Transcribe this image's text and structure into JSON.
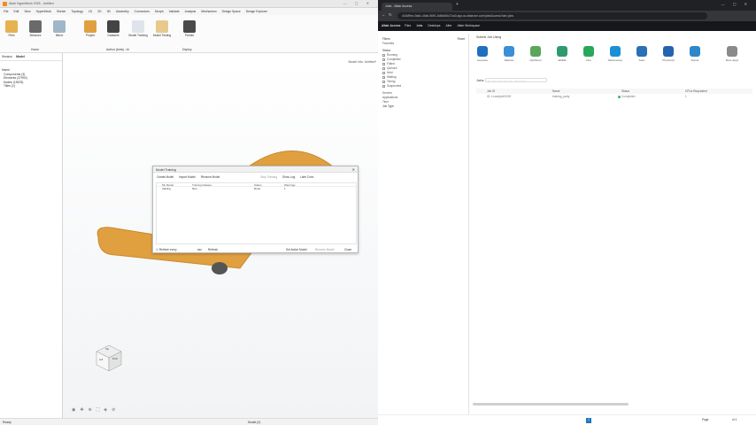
{
  "left_app": {
    "title": "Altair HyperMesh 2025 - Untitled",
    "menu": [
      "File",
      "Edit",
      "View",
      "HyperMesh",
      "Sketch",
      "Topology",
      "1D",
      "2D",
      "3D",
      "Assembly",
      "Connectors",
      "Morph",
      "Validate",
      "Analysis",
      "Mechanism",
      "Design Space",
      "Design Explorer"
    ],
    "ribbon_tools": [
      {
        "name": "files-tool",
        "label": "Files"
      },
      {
        "name": "measure-tool",
        "label": "Measure"
      },
      {
        "name": "mirror-tool",
        "label": "Mirror"
      },
      {
        "name": "project-tool",
        "label": "Project"
      },
      {
        "name": "datasets-tool",
        "label": "Datasets"
      },
      {
        "name": "model-training-tool",
        "label": "Model Training"
      },
      {
        "name": "model-testing-tool",
        "label": "Model Testing"
      },
      {
        "name": "predict-tool",
        "label": "Predict"
      }
    ],
    "group_home": "Home",
    "group_author": "Author (beta) - AI",
    "group_deploy": "Deploy",
    "browser_tabs": [
      "Session",
      "Model"
    ],
    "tree_header": "Name",
    "tree": [
      "Components (3)",
      "Elements (37992)",
      "Nodes (19678)",
      "Titles (1)"
    ],
    "viewport_label": "Model Info: Untitled*",
    "status": "Ready",
    "status_center": "Model (2)",
    "viewcube": {
      "top": "Top",
      "left": "Left",
      "front": "Front"
    }
  },
  "dialog": {
    "title": "Model Training",
    "toolbar": [
      "Create Model",
      "Import Model",
      "Remove Model",
      "Stop Training",
      "Show Log",
      "Liste Conn"
    ],
    "columns": [
      "ML Model",
      "Training Dataset",
      "Status",
      "Warnings"
    ],
    "row": {
      "model": "training",
      "dataset": "Nan",
      "status": "Done",
      "warnings": "1"
    },
    "footer_left": "Refresh every",
    "footer_sec": "sec",
    "footer_refresh": "Refresh",
    "footer_buttons": [
      "Set Active Model",
      "Remove Model",
      "Close"
    ]
  },
  "right_app": {
    "tab_active": "Jobs - Altair Access",
    "url": "415df9ec-9a6c-44bd-9691-5d5db8417ca0.app.az.altairone.com/jobs/Access?tab=jobs",
    "brand": "Altair Access",
    "nav": [
      "Files",
      "Jobs",
      "Desktops",
      "Alter",
      "Altair Workspace"
    ],
    "filters_title": "Filters",
    "filters_reset": "Reset",
    "filter_sub": "Favorites",
    "status_title": "Status",
    "statuses": [
      "Running",
      "Completed",
      "Failed",
      "Queued",
      "Held",
      "Waiting",
      "Timing",
      "Suspended"
    ],
    "more_filters": [
      "Servers",
      "Applications",
      "Time",
      "Job Type"
    ],
    "submit_title": "Submit Job Using",
    "solvers": [
      "Acusolve",
      "Radioss",
      "OptiStruct",
      "EDEM",
      "Flux",
      "Motionsolve",
      "Feko",
      "PhysicsAI",
      "Romai",
      "More Apps"
    ],
    "jobs_title": "Jobs",
    "search_placeholder": "Search using job name, job id, host",
    "columns": [
      "Job ID",
      "Name",
      "Status",
      "CPUs Requested"
    ],
    "job": {
      "id": "ID-1-nodejob00000",
      "name": "training_party",
      "status": "Completed",
      "cpus": "1"
    },
    "page_label": "Page",
    "page_current": "1",
    "page_total": "of 1"
  },
  "colors": {
    "accent": "#1f78c1",
    "shape": "#e0a040",
    "ok": "#3bb36c"
  }
}
